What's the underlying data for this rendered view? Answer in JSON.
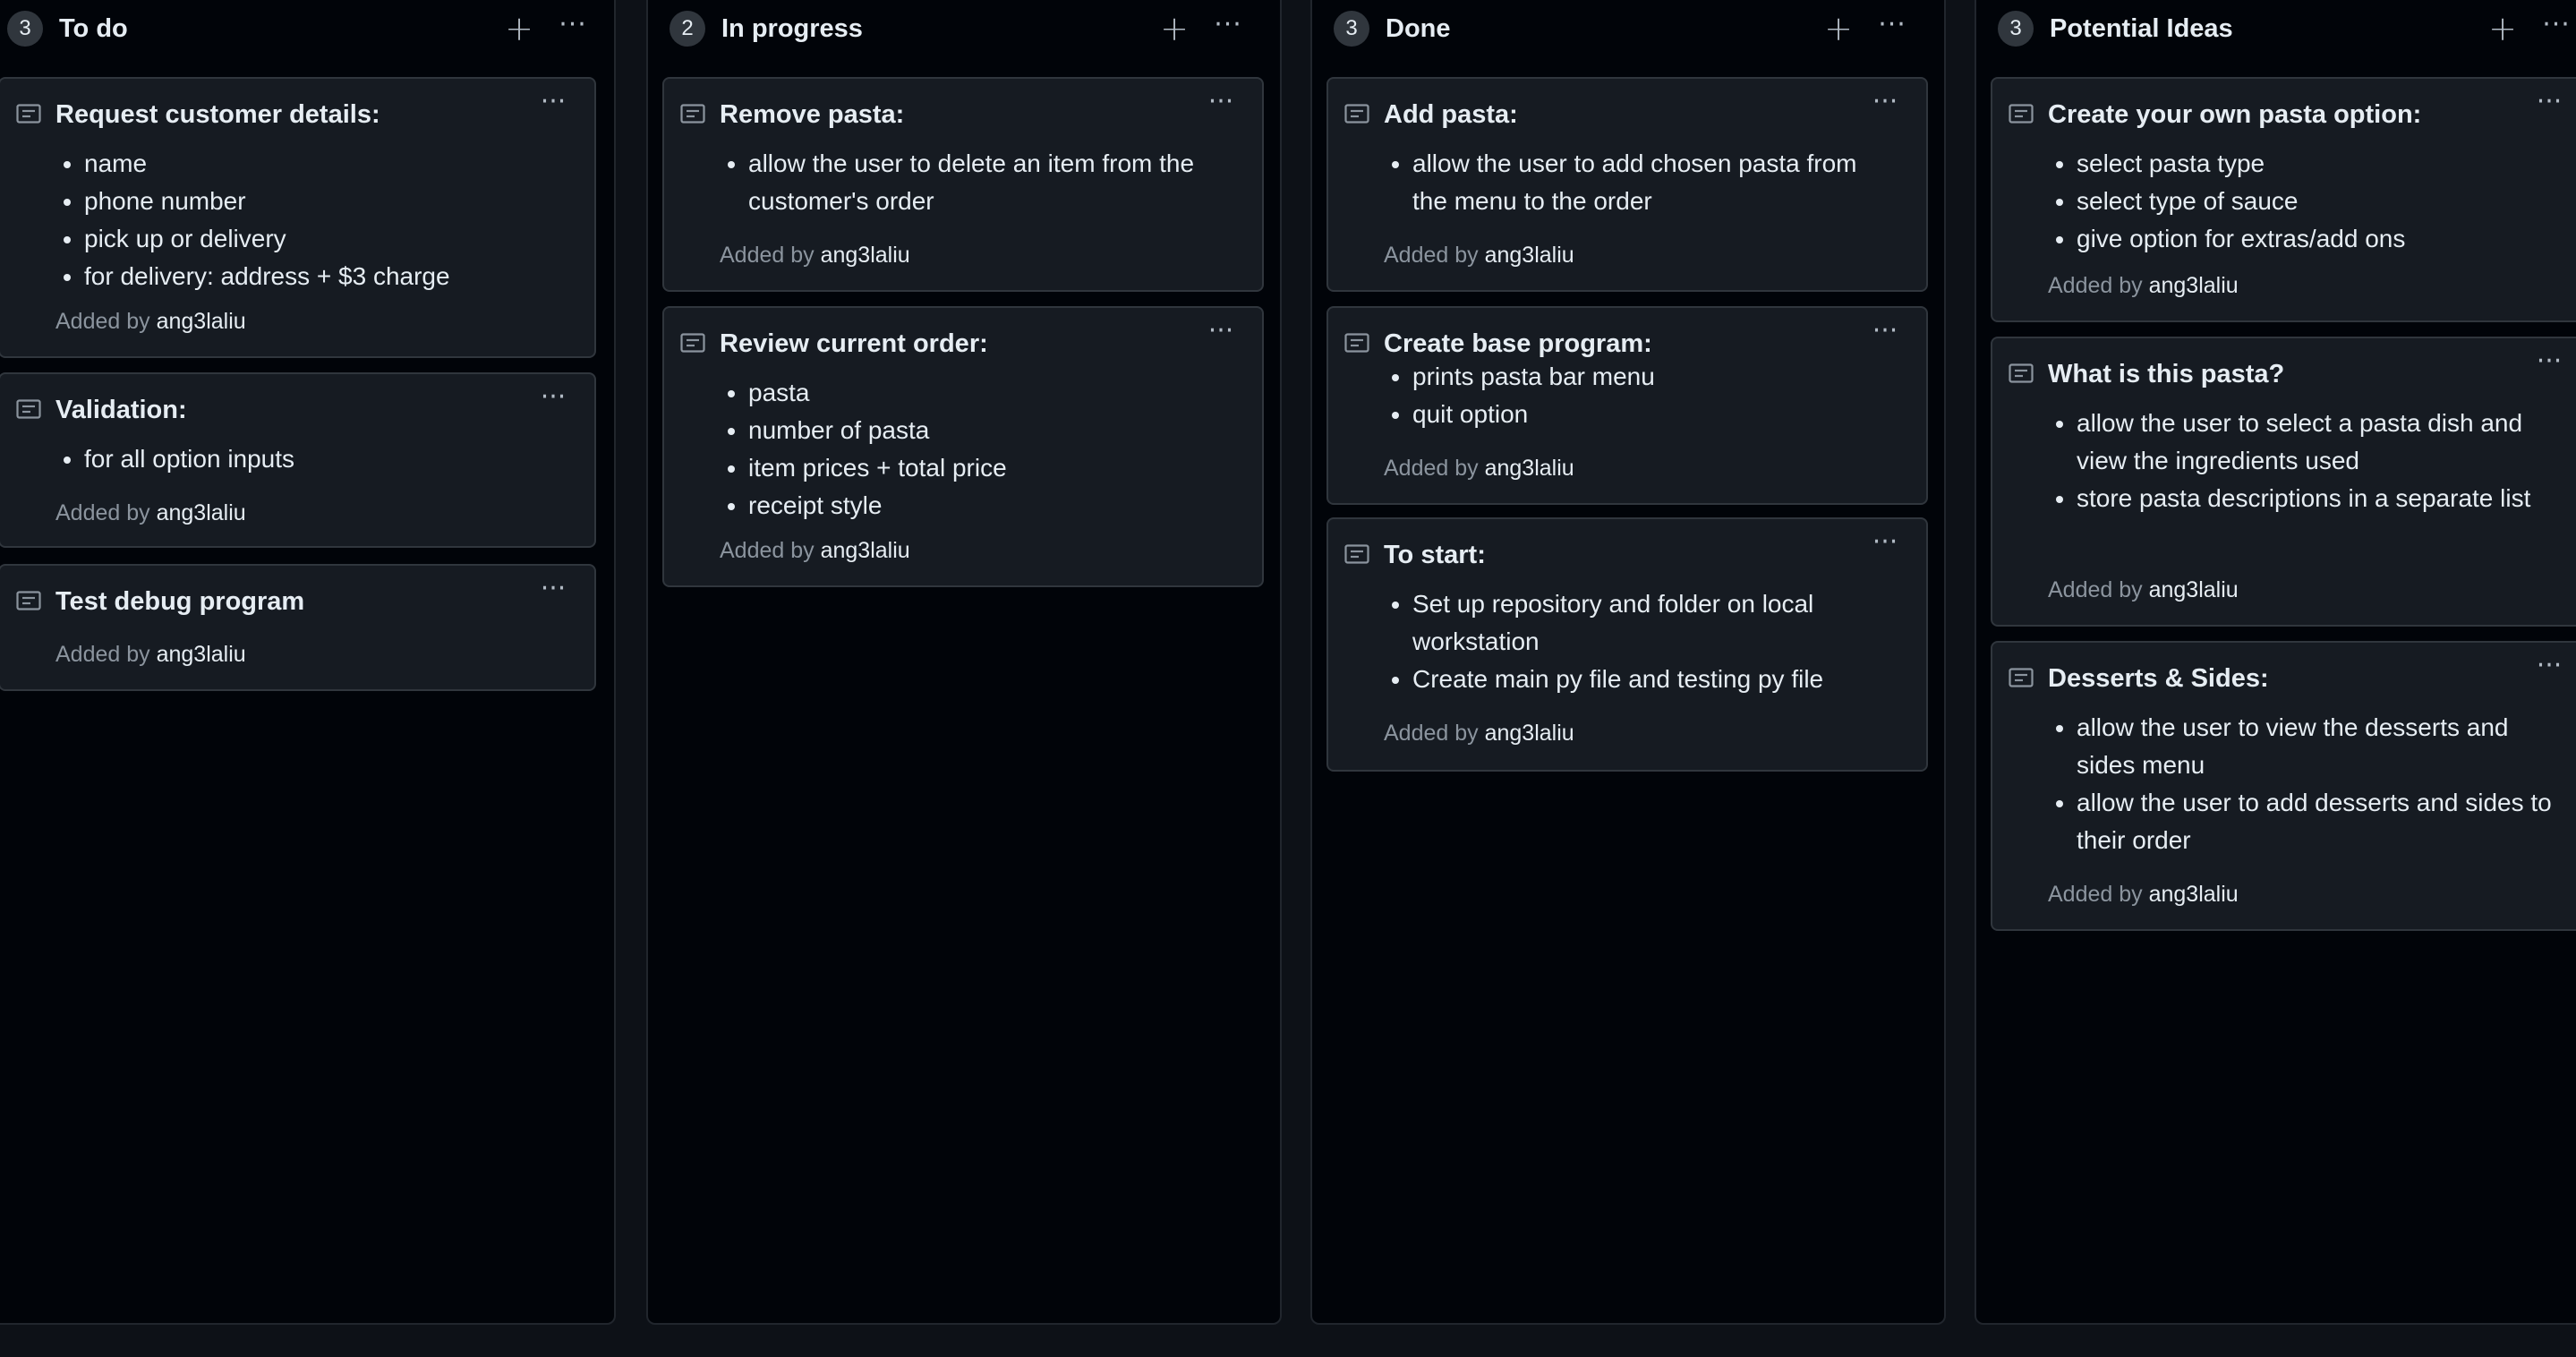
{
  "colors": {
    "background": "#0d1117",
    "column_bg": "#010409",
    "card_bg": "#161b22",
    "border": "#30363d",
    "text": "#e6edf3",
    "muted": "#8b949e"
  },
  "board": {
    "columns": [
      {
        "count": "3",
        "title": "To do",
        "add_icon": "plus-icon",
        "more_icon": "kebab-horizontal-icon",
        "cards": [
          {
            "title": "Request customer details:",
            "items": [
              "name",
              "phone number",
              "pick up or delivery",
              "for delivery: address + $3 charge"
            ],
            "added_label": "Added by",
            "user": "ang3laliu"
          },
          {
            "title": "Validation:",
            "items": [
              "for all option inputs"
            ],
            "added_label": "Added by",
            "user": "ang3laliu"
          },
          {
            "title": "Test debug program",
            "items": [],
            "added_label": "Added by",
            "user": "ang3laliu"
          }
        ]
      },
      {
        "count": "2",
        "title": "In progress",
        "add_icon": "plus-icon",
        "more_icon": "kebab-horizontal-icon",
        "cards": [
          {
            "title": "Remove pasta:",
            "items": [
              "allow the user to delete an item from the customer's order"
            ],
            "added_label": "Added by",
            "user": "ang3laliu"
          },
          {
            "title": "Review current order:",
            "items": [
              "pasta",
              "number of pasta",
              "item prices + total price",
              "receipt style"
            ],
            "added_label": "Added by",
            "user": "ang3laliu"
          }
        ]
      },
      {
        "count": "3",
        "title": "Done",
        "add_icon": "plus-icon",
        "more_icon": "kebab-horizontal-icon",
        "cards": [
          {
            "title": "Add pasta:",
            "items": [
              "allow the user to add chosen pasta from the menu to the order"
            ],
            "added_label": "Added by",
            "user": "ang3laliu"
          },
          {
            "title": "Create base program:",
            "items": [
              "prints pasta bar menu",
              "quit option"
            ],
            "added_label": "Added by",
            "user": "ang3laliu"
          },
          {
            "title": "To start:",
            "items": [
              "Set up repository and folder on local workstation",
              "Create main py file and testing py file"
            ],
            "added_label": "Added by",
            "user": "ang3laliu"
          }
        ]
      },
      {
        "count": "3",
        "title": "Potential Ideas",
        "add_icon": "plus-icon",
        "more_icon": "kebab-horizontal-icon",
        "cards": [
          {
            "title": "Create your own pasta option:",
            "items": [
              "select pasta type",
              "select type of sauce",
              "give option for extras/add ons"
            ],
            "added_label": "Added by",
            "user": "ang3laliu"
          },
          {
            "title": "What is this pasta?",
            "items": [
              "allow the user to select a pasta dish and view the ingredients used",
              "store pasta descriptions in a separate list"
            ],
            "added_label": "Added by",
            "user": "ang3laliu"
          },
          {
            "title": "Desserts & Sides:",
            "items": [
              "allow the user to view the desserts and sides menu",
              "allow the user to add desserts and sides to their order"
            ],
            "added_label": "Added by",
            "user": "ang3laliu"
          }
        ]
      }
    ]
  }
}
